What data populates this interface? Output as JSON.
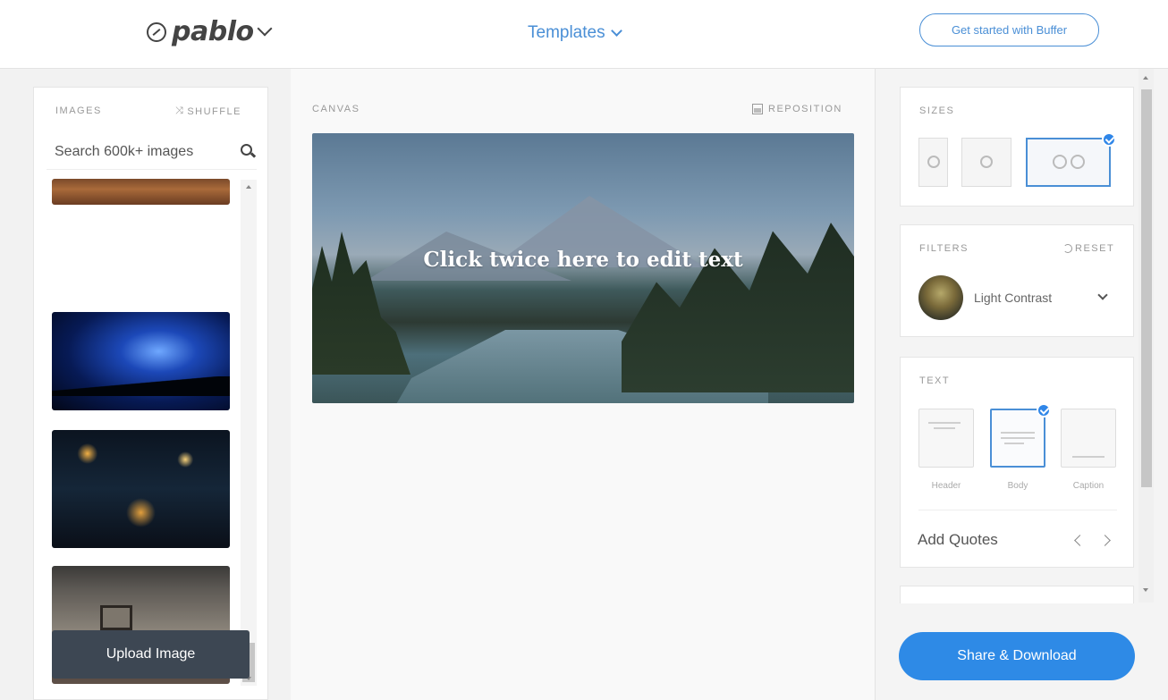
{
  "header": {
    "logo_text": "pablo",
    "templates_label": "Templates",
    "cta_label": "Get started with Buffer"
  },
  "images_panel": {
    "heading": "IMAGES",
    "shuffle_label": "SHUFFLE",
    "search_placeholder": "Search 600k+ images",
    "upload_label": "Upload Image"
  },
  "canvas_panel": {
    "heading": "CANVAS",
    "reposition_label": "REPOSITION",
    "canvas_text": "Click twice here to edit text"
  },
  "sizes_panel": {
    "heading": "SIZES",
    "options": [
      {
        "icon": "pinterest-icon",
        "selected": false
      },
      {
        "icon": "instagram-icon",
        "selected": false
      },
      {
        "icon": "facebook-twitter-icon",
        "selected": true
      }
    ]
  },
  "filters_panel": {
    "heading": "FILTERS",
    "reset_label": "RESET",
    "selected_filter": "Light Contrast"
  },
  "text_panel": {
    "heading": "TEXT",
    "styles": [
      {
        "label": "Header",
        "selected": false
      },
      {
        "label": "Body",
        "selected": true
      },
      {
        "label": "Caption",
        "selected": false
      }
    ],
    "quotes_label": "Add Quotes"
  },
  "share_label": "Share & Download",
  "colors": {
    "accent": "#4a8fd6",
    "primary_button": "#2e8ae6",
    "upload_button": "#3d4753"
  }
}
